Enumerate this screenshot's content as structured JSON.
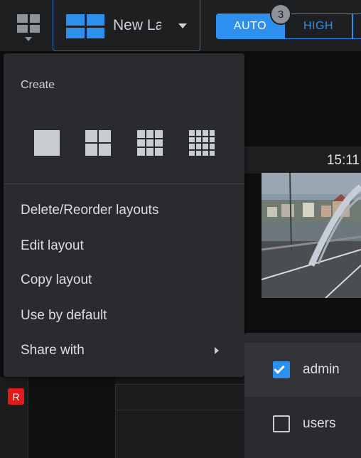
{
  "toolbar": {
    "layout_name": "New La",
    "quality": {
      "auto_label": "AUTO",
      "high_label": "HIGH"
    },
    "badge_count": "3",
    "accent_color": "#2e90ee"
  },
  "camera_tile": {
    "timestamp": "15:11"
  },
  "recording_badge": "R",
  "menu": {
    "create_title": "Create",
    "create_options": [
      "1x1-layout-icon",
      "2x2-layout-icon",
      "3x3-layout-icon",
      "4x4-layout-icon"
    ],
    "items": [
      {
        "label": "Delete/Reorder layouts"
      },
      {
        "label": "Edit layout"
      },
      {
        "label": "Copy layout"
      },
      {
        "label": "Use by default"
      },
      {
        "label": "Share with",
        "has_submenu": true
      }
    ]
  },
  "share_submenu": {
    "items": [
      {
        "label": "admin",
        "checked": true
      },
      {
        "label": "users",
        "checked": false
      }
    ]
  }
}
